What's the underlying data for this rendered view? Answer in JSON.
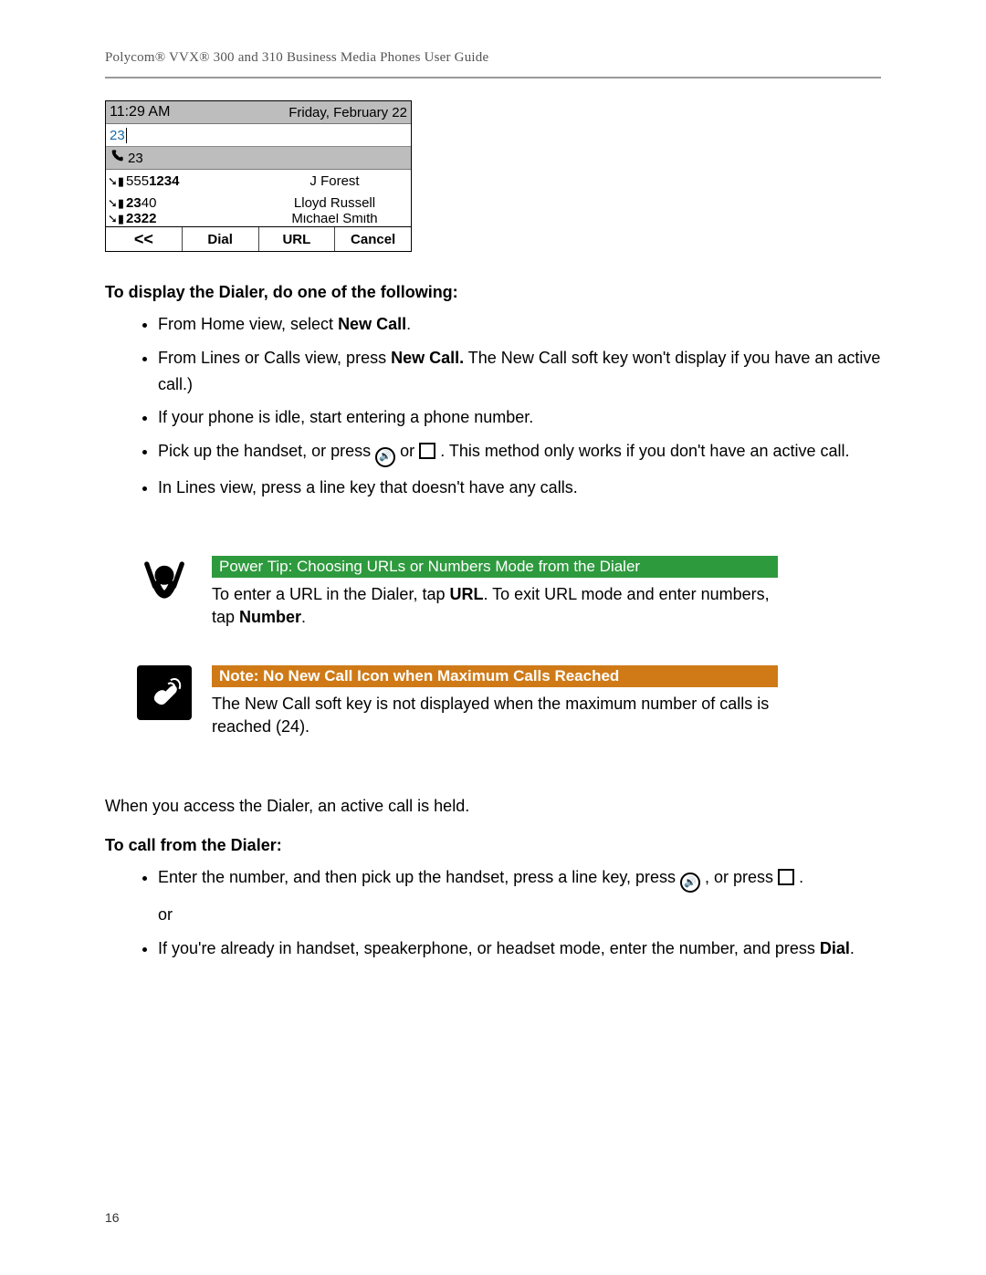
{
  "header": {
    "title": "Polycom® VVX® 300 and 310 Business Media Phones User Guide"
  },
  "phone": {
    "time": "11:29 AM",
    "date": "Friday, February 22",
    "input_value": "23",
    "line_label": "23",
    "list": [
      {
        "number": "5551234",
        "name": "J Forest"
      },
      {
        "number": "2340",
        "name": "Lloyd Russell"
      },
      {
        "number": "2322",
        "name": "Michael Smith"
      }
    ],
    "softkeys": {
      "back": "<<",
      "dial": "Dial",
      "url": "URL",
      "cancel": "Cancel"
    }
  },
  "section1": {
    "heading": "To display the Dialer, do one of the following:",
    "items": {
      "i1_a": "From Home view, select ",
      "i1_b": "New Call",
      "i1_c": ".",
      "i2_a": "From Lines or Calls view, press ",
      "i2_b": "New Call.",
      "i2_c": " The New Call soft key won't display if you have an active call.)",
      "i3": "If your phone is idle, start entering a phone number.",
      "i4_a": "Pick up the handset, or press ",
      "i4_b": " or ",
      "i4_c": ". This method only works if you don't have an active call.",
      "i5": "In Lines view, press a line key that doesn't have any calls."
    }
  },
  "tip": {
    "title": "Power Tip: Choosing URLs or Numbers Mode from the Dialer",
    "text_a": "To enter a URL in the Dialer, tap ",
    "text_b": "URL",
    "text_c": ". To exit URL mode and enter numbers, tap ",
    "text_d": "Number",
    "text_e": "."
  },
  "note": {
    "title": "Note: No New Call Icon when Maximum Calls Reached",
    "text": "The New Call soft key is not displayed when the maximum number of calls is reached (24)."
  },
  "para_between": "When you access the Dialer, an active call is held.",
  "section2": {
    "heading": "To call from the Dialer:",
    "items": {
      "i1_a": "Enter the number, and then pick up the handset, press a line key, press ",
      "i1_b": ", or press ",
      "i1_c": ".",
      "or": "or",
      "i2_a": "If you're already in handset, speakerphone, or headset mode, enter the number, and press ",
      "i2_b": "Dial",
      "i2_c": "."
    }
  },
  "page_number": "16"
}
